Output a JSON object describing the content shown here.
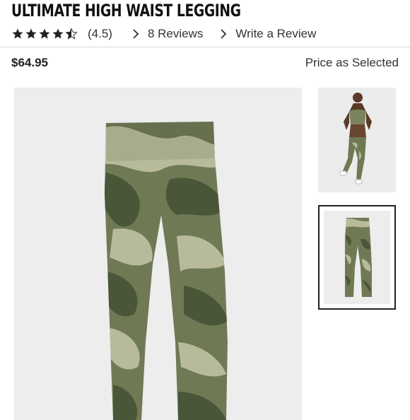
{
  "product": {
    "title": "ULTIMATE HIGH WAIST LEGGING",
    "rating_value": 4.5,
    "rating_text": "(4.5)",
    "reviews_label": "8 Reviews",
    "write_review_label": "Write a Review",
    "price": "$64.95",
    "price_note": "Price as Selected"
  },
  "colors": {
    "camo_dark": "#4a5638",
    "camo_mid": "#6f7a55",
    "camo_light": "#b7bb9c",
    "image_bg": "#ededed"
  },
  "icons": {
    "star": "star-icon",
    "chevron": "chevron-right-icon"
  },
  "gallery": {
    "thumbnails": [
      {
        "label": "model-view",
        "selected": false
      },
      {
        "label": "product-view",
        "selected": true
      }
    ]
  }
}
